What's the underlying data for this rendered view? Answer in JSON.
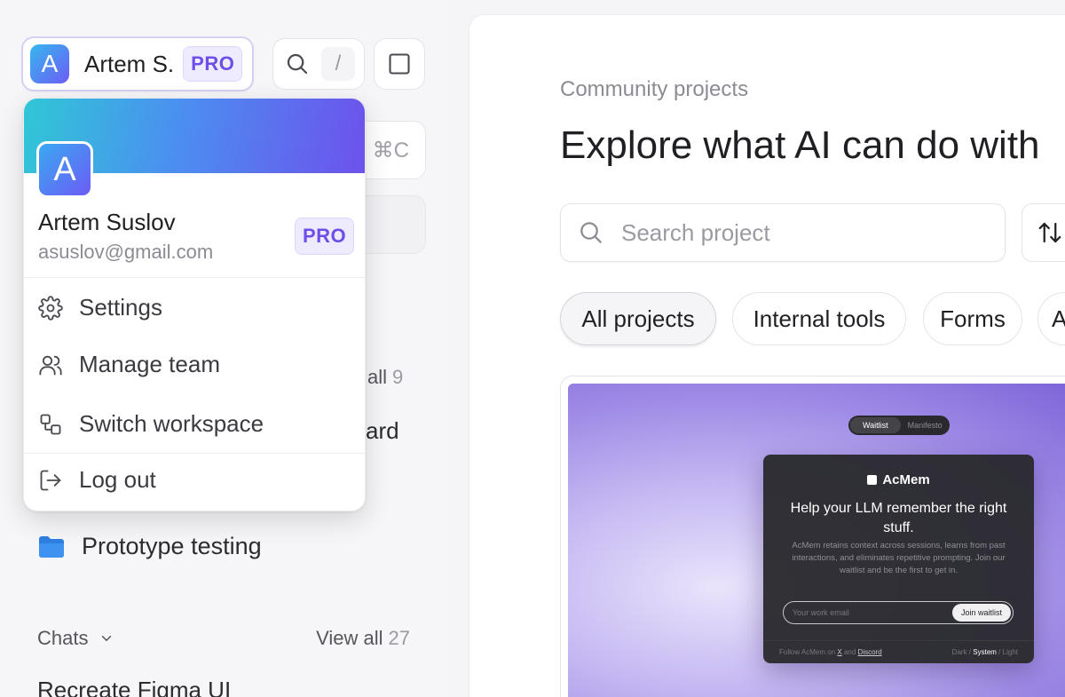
{
  "user": {
    "initial": "A",
    "short_name": "Artem S.",
    "full_name": "Artem Suslov",
    "email": "asuslov@gmail.com",
    "plan_badge": "PRO"
  },
  "topbar": {
    "search_shortcut": "/",
    "copy_shortcut": "⌘C"
  },
  "menu": {
    "items": [
      {
        "label": "Settings",
        "icon": "gear-icon"
      },
      {
        "label": "Manage team",
        "icon": "users-icon"
      },
      {
        "label": "Switch workspace",
        "icon": "switch-workspace-icon"
      },
      {
        "label": "Log out",
        "icon": "logout-icon"
      }
    ]
  },
  "sidebar": {
    "partial_view_all": "all",
    "partial_view_all_count": "9",
    "partial_item": "ard",
    "folder_label": "Prototype testing",
    "chats_title": "Chats",
    "chats_view_all": "View all",
    "chats_count": "27",
    "chat_item": "Recreate Figma UI"
  },
  "main": {
    "eyebrow": "Community projects",
    "headline": "Explore what AI can do with",
    "search_placeholder": "Search project",
    "sort_icon": "sort-arrows-icon",
    "filters": [
      "All projects",
      "Internal tools",
      "Forms",
      "A"
    ]
  },
  "preview": {
    "toggle_active": "Waitlist",
    "toggle_inactive": "Manifesto",
    "brand": "AcMem",
    "title": "Help your LLM remember the right stuff.",
    "description": "AcMem retains context across sessions, learns from past interactions, and eliminates repetitive prompting. Join our waitlist and be the first to get in.",
    "input_placeholder": "Your work email",
    "join_button": "Join waitlist",
    "footer_prefix": "Follow AcMem on",
    "footer_x": "X",
    "footer_and": "and",
    "footer_discord": "Discord",
    "theme_dark": "Dark",
    "theme_system": "System",
    "theme_light": "Light",
    "theme_sep": "/"
  },
  "colors": {
    "accent": "#6d4fe8",
    "folder": "#2f7fe0"
  }
}
